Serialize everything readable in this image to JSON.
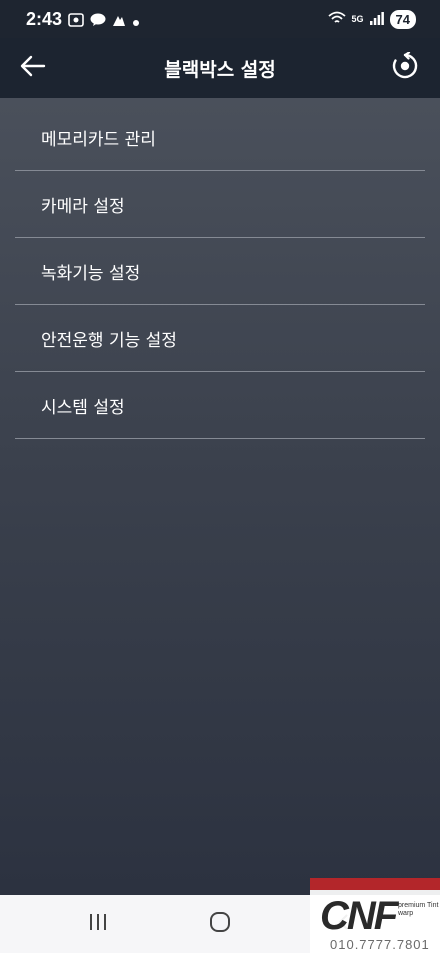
{
  "status_bar": {
    "time": "2:43",
    "network_label": "5G",
    "battery": "74",
    "icons": [
      "screenshot-icon",
      "kakaotalk-icon",
      "app-icon",
      "dot-icon",
      "wifi-icon",
      "signal-icon"
    ]
  },
  "header": {
    "title": "블랙박스 설정",
    "back_icon": "arrow-left-icon",
    "action_icon": "sync-icon"
  },
  "menu": {
    "items": [
      {
        "label": "메모리카드 관리"
      },
      {
        "label": "카메라 설정"
      },
      {
        "label": "녹화기능 설정"
      },
      {
        "label": "안전운행 기능 설정"
      },
      {
        "label": "시스템 설정"
      }
    ]
  },
  "nav_bar": {
    "icons": [
      "recent-apps-icon",
      "home-icon",
      "back-icon"
    ]
  },
  "watermark": {
    "logo": "CNF",
    "subtitle": "premium Tint warp",
    "phone": "010.7777.7801"
  },
  "colors": {
    "status_bar_bg": "#1e2530",
    "app_bar_bg": "#1c2430",
    "content_bg": "#3b414d",
    "divider": "#858a94",
    "text": "#ffffff",
    "nav_bar_bg": "#f6f6f8",
    "watermark_accent": "#b3262a"
  }
}
